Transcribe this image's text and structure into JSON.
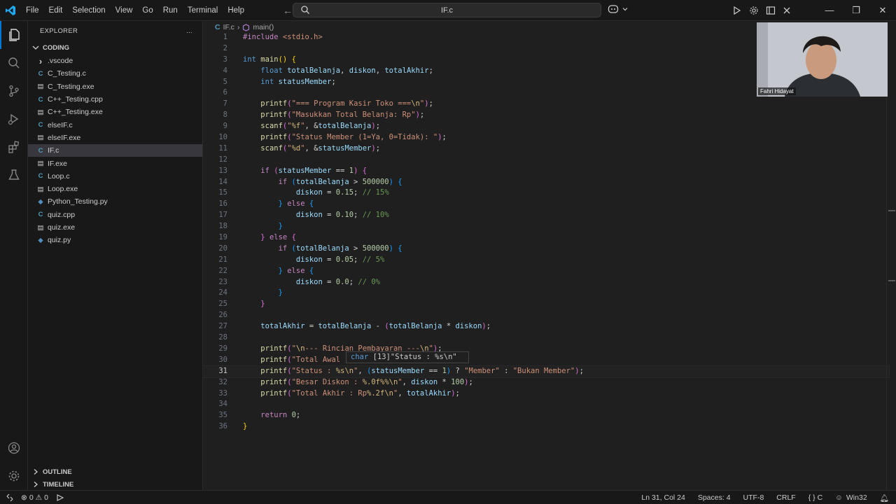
{
  "menu": [
    "File",
    "Edit",
    "Selection",
    "View",
    "Go",
    "Run",
    "Terminal",
    "Help"
  ],
  "command_center": {
    "title": "IF.c"
  },
  "sidebar": {
    "header": "EXPLORER",
    "more": "...",
    "folder": "CODING",
    "items": [
      {
        "label": ".vscode",
        "icon": "chevron-right-icon",
        "type": "folder"
      },
      {
        "label": "C_Testing.c",
        "icon": "c-file-icon",
        "type": "c"
      },
      {
        "label": "C_Testing.exe",
        "icon": "exe-file-icon",
        "type": "exe"
      },
      {
        "label": "C++_Testing.cpp",
        "icon": "cpp-file-icon",
        "type": "cpp"
      },
      {
        "label": "C++_Testing.exe",
        "icon": "exe-file-icon",
        "type": "exe"
      },
      {
        "label": "elseIF.c",
        "icon": "c-file-icon",
        "type": "c"
      },
      {
        "label": "elseIF.exe",
        "icon": "exe-file-icon",
        "type": "exe"
      },
      {
        "label": "IF.c",
        "icon": "c-file-icon",
        "type": "c",
        "selected": true
      },
      {
        "label": "IF.exe",
        "icon": "exe-file-icon",
        "type": "exe"
      },
      {
        "label": "Loop.c",
        "icon": "c-file-icon",
        "type": "c"
      },
      {
        "label": "Loop.exe",
        "icon": "exe-file-icon",
        "type": "exe"
      },
      {
        "label": "Python_Testing.py",
        "icon": "python-file-icon",
        "type": "py"
      },
      {
        "label": "quiz.cpp",
        "icon": "cpp-file-icon",
        "type": "cpp"
      },
      {
        "label": "quiz.exe",
        "icon": "exe-file-icon",
        "type": "exe"
      },
      {
        "label": "quiz.py",
        "icon": "python-file-icon",
        "type": "py"
      }
    ],
    "outline": "OUTLINE",
    "timeline": "TIMELINE"
  },
  "breadcrumb": {
    "file_badge": "C",
    "file": "IF.c",
    "symbol": "main()"
  },
  "editor": {
    "current_line": 31,
    "lines": [
      [
        [
          "pp",
          "#include "
        ],
        [
          "inc",
          "<stdio.h>"
        ]
      ],
      [],
      [
        [
          "k",
          "int "
        ],
        [
          "fn",
          "main"
        ],
        [
          "b1",
          "()"
        ],
        [
          "p",
          " "
        ],
        [
          "b1",
          "{"
        ]
      ],
      [
        [
          "p",
          "    "
        ],
        [
          "k",
          "float "
        ],
        [
          "v",
          "totalBelanja"
        ],
        [
          "p",
          ", "
        ],
        [
          "v",
          "diskon"
        ],
        [
          "p",
          ", "
        ],
        [
          "v",
          "totalAkhir"
        ],
        [
          "p",
          ";"
        ]
      ],
      [
        [
          "p",
          "    "
        ],
        [
          "k",
          "int "
        ],
        [
          "v",
          "statusMember"
        ],
        [
          "p",
          ";"
        ]
      ],
      [],
      [
        [
          "p",
          "    "
        ],
        [
          "fn",
          "printf"
        ],
        [
          "b2",
          "("
        ],
        [
          "s",
          "\"=== Program Kasir Toko ==="
        ],
        [
          "esc",
          "\\n"
        ],
        [
          "s",
          "\""
        ],
        [
          "b2",
          ")"
        ],
        [
          "p",
          ";"
        ]
      ],
      [
        [
          "p",
          "    "
        ],
        [
          "fn",
          "printf"
        ],
        [
          "b2",
          "("
        ],
        [
          "s",
          "\"Masukkan Total Belanja: Rp\""
        ],
        [
          "b2",
          ")"
        ],
        [
          "p",
          ";"
        ]
      ],
      [
        [
          "p",
          "    "
        ],
        [
          "fn",
          "scanf"
        ],
        [
          "b2",
          "("
        ],
        [
          "s",
          "\""
        ],
        [
          "esc",
          "%f"
        ],
        [
          "s",
          "\""
        ],
        [
          "p",
          ", &"
        ],
        [
          "v",
          "totalBelanja"
        ],
        [
          "b2",
          ")"
        ],
        [
          "p",
          ";"
        ]
      ],
      [
        [
          "p",
          "    "
        ],
        [
          "fn",
          "printf"
        ],
        [
          "b2",
          "("
        ],
        [
          "s",
          "\"Status Member (1=Ya, 0=Tidak): \""
        ],
        [
          "b2",
          ")"
        ],
        [
          "p",
          ";"
        ]
      ],
      [
        [
          "p",
          "    "
        ],
        [
          "fn",
          "scanf"
        ],
        [
          "b2",
          "("
        ],
        [
          "s",
          "\""
        ],
        [
          "esc",
          "%d"
        ],
        [
          "s",
          "\""
        ],
        [
          "p",
          ", &"
        ],
        [
          "v",
          "statusMember"
        ],
        [
          "b2",
          ")"
        ],
        [
          "p",
          ";"
        ]
      ],
      [],
      [
        [
          "p",
          "    "
        ],
        [
          "kc",
          "if "
        ],
        [
          "b2",
          "("
        ],
        [
          "v",
          "statusMember"
        ],
        [
          "p",
          " == "
        ],
        [
          "n",
          "1"
        ],
        [
          "b2",
          ")"
        ],
        [
          "p",
          " "
        ],
        [
          "b2",
          "{"
        ]
      ],
      [
        [
          "p",
          "        "
        ],
        [
          "kc",
          "if "
        ],
        [
          "b3",
          "("
        ],
        [
          "v",
          "totalBelanja"
        ],
        [
          "p",
          " > "
        ],
        [
          "n",
          "500000"
        ],
        [
          "b3",
          ")"
        ],
        [
          "p",
          " "
        ],
        [
          "b3",
          "{"
        ]
      ],
      [
        [
          "p",
          "            "
        ],
        [
          "v",
          "diskon"
        ],
        [
          "p",
          " = "
        ],
        [
          "n",
          "0.15"
        ],
        [
          "p",
          "; "
        ],
        [
          "cm",
          "// 15%"
        ]
      ],
      [
        [
          "p",
          "        "
        ],
        [
          "b3",
          "}"
        ],
        [
          "p",
          " "
        ],
        [
          "kc",
          "else"
        ],
        [
          "p",
          " "
        ],
        [
          "b3",
          "{"
        ]
      ],
      [
        [
          "p",
          "            "
        ],
        [
          "v",
          "diskon"
        ],
        [
          "p",
          " = "
        ],
        [
          "n",
          "0.10"
        ],
        [
          "p",
          "; "
        ],
        [
          "cm",
          "// 10%"
        ]
      ],
      [
        [
          "p",
          "        "
        ],
        [
          "b3",
          "}"
        ]
      ],
      [
        [
          "p",
          "    "
        ],
        [
          "b2",
          "}"
        ],
        [
          "p",
          " "
        ],
        [
          "kc",
          "else"
        ],
        [
          "p",
          " "
        ],
        [
          "b2",
          "{"
        ]
      ],
      [
        [
          "p",
          "        "
        ],
        [
          "kc",
          "if "
        ],
        [
          "b3",
          "("
        ],
        [
          "v",
          "totalBelanja"
        ],
        [
          "p",
          " > "
        ],
        [
          "n",
          "500000"
        ],
        [
          "b3",
          ")"
        ],
        [
          "p",
          " "
        ],
        [
          "b3",
          "{"
        ]
      ],
      [
        [
          "p",
          "            "
        ],
        [
          "v",
          "diskon"
        ],
        [
          "p",
          " = "
        ],
        [
          "n",
          "0.05"
        ],
        [
          "p",
          "; "
        ],
        [
          "cm",
          "// 5%"
        ]
      ],
      [
        [
          "p",
          "        "
        ],
        [
          "b3",
          "}"
        ],
        [
          "p",
          " "
        ],
        [
          "kc",
          "else"
        ],
        [
          "p",
          " "
        ],
        [
          "b3",
          "{"
        ]
      ],
      [
        [
          "p",
          "            "
        ],
        [
          "v",
          "diskon"
        ],
        [
          "p",
          " = "
        ],
        [
          "n",
          "0.0"
        ],
        [
          "p",
          "; "
        ],
        [
          "cm",
          "// 0%"
        ]
      ],
      [
        [
          "p",
          "        "
        ],
        [
          "b3",
          "}"
        ]
      ],
      [
        [
          "p",
          "    "
        ],
        [
          "b2",
          "}"
        ]
      ],
      [],
      [
        [
          "p",
          "    "
        ],
        [
          "v",
          "totalAkhir"
        ],
        [
          "p",
          " = "
        ],
        [
          "v",
          "totalBelanja"
        ],
        [
          "p",
          " - "
        ],
        [
          "b2",
          "("
        ],
        [
          "v",
          "totalBelanja"
        ],
        [
          "p",
          " * "
        ],
        [
          "v",
          "diskon"
        ],
        [
          "b2",
          ")"
        ],
        [
          "p",
          ";"
        ]
      ],
      [],
      [
        [
          "p",
          "    "
        ],
        [
          "fn",
          "printf"
        ],
        [
          "b2",
          "("
        ],
        [
          "s",
          "\""
        ],
        [
          "esc",
          "\\n"
        ],
        [
          "s",
          "--- Rincian Pembayaran ---"
        ],
        [
          "esc",
          "\\n"
        ],
        [
          "s",
          "\""
        ],
        [
          "b2",
          ")"
        ],
        [
          "p",
          ";"
        ]
      ],
      [
        [
          "p",
          "    "
        ],
        [
          "fn",
          "printf"
        ],
        [
          "b2",
          "("
        ],
        [
          "s",
          "\"Total Awal"
        ]
      ],
      [
        [
          "p",
          "    "
        ],
        [
          "fn",
          "printf"
        ],
        [
          "b2",
          "("
        ],
        [
          "s",
          "\"Status : "
        ],
        [
          "esc",
          "%s"
        ],
        [
          "esc",
          "\\n"
        ],
        [
          "s",
          "\""
        ],
        [
          "p",
          ", "
        ],
        [
          "b3",
          "("
        ],
        [
          "v",
          "statusMember"
        ],
        [
          "p",
          " == "
        ],
        [
          "n",
          "1"
        ],
        [
          "b3",
          ")"
        ],
        [
          "p",
          " ? "
        ],
        [
          "s",
          "\"Member\""
        ],
        [
          "p",
          " : "
        ],
        [
          "s",
          "\"Bukan Member\""
        ],
        [
          "b2",
          ")"
        ],
        [
          "p",
          ";"
        ]
      ],
      [
        [
          "p",
          "    "
        ],
        [
          "fn",
          "printf"
        ],
        [
          "b2",
          "("
        ],
        [
          "s",
          "\"Besar Diskon : "
        ],
        [
          "esc",
          "%.0f%%"
        ],
        [
          "esc",
          "\\n"
        ],
        [
          "s",
          "\""
        ],
        [
          "p",
          ", "
        ],
        [
          "v",
          "diskon"
        ],
        [
          "p",
          " * "
        ],
        [
          "n",
          "100"
        ],
        [
          "b2",
          ")"
        ],
        [
          "p",
          ";"
        ]
      ],
      [
        [
          "p",
          "    "
        ],
        [
          "fn",
          "printf"
        ],
        [
          "b2",
          "("
        ],
        [
          "s",
          "\"Total Akhir : Rp"
        ],
        [
          "esc",
          "%.2f"
        ],
        [
          "esc",
          "\\n"
        ],
        [
          "s",
          "\""
        ],
        [
          "p",
          ", "
        ],
        [
          "v",
          "totalAkhir"
        ],
        [
          "b2",
          ")"
        ],
        [
          "p",
          ";"
        ]
      ],
      [],
      [
        [
          "p",
          "    "
        ],
        [
          "kc",
          "return "
        ],
        [
          "n",
          "0"
        ],
        [
          "p",
          ";"
        ]
      ],
      [
        [
          "b1",
          "}"
        ]
      ]
    ]
  },
  "hover": {
    "type": "char",
    "size": "[13]",
    "value": "\"Status : %s\\n\""
  },
  "webcam": {
    "name": "Fahri Hidayat"
  },
  "status": {
    "errors": "0",
    "warnings": "0",
    "position": "Ln 31, Col 24",
    "spaces": "Spaces: 4",
    "encoding": "UTF-8",
    "eol": "CRLF",
    "language": "{ } C",
    "platform": "Win32"
  },
  "colors": {
    "accent": "#0078d4",
    "background": "#1f1f1f",
    "sidebar": "#181818"
  }
}
